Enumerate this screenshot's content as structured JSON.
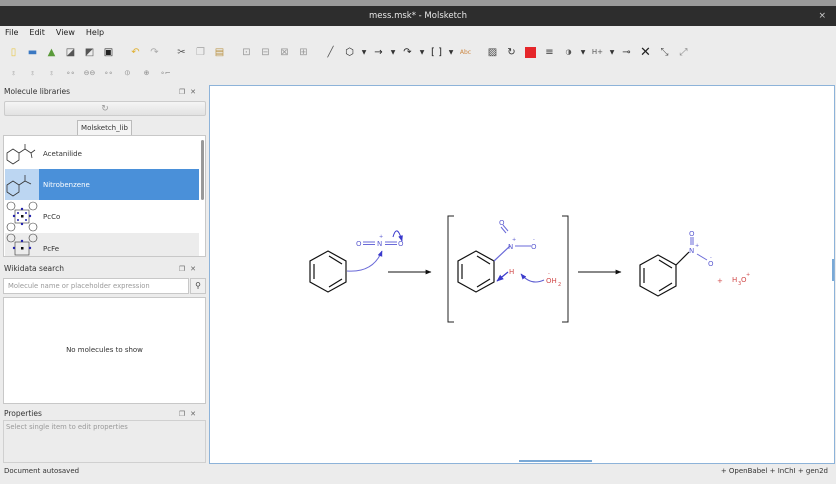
{
  "window": {
    "title": "mess.msk* - Molsketch",
    "close": "×"
  },
  "menu": [
    "File",
    "Edit",
    "View",
    "Help"
  ],
  "toolbar": {
    "charge_label": "H+",
    "text_tool_label": "Abc",
    "accent_color": "#e5262a"
  },
  "molecule_libraries": {
    "title": "Molecule libraries",
    "tab": "Molsketch_lib",
    "items": [
      {
        "name": "Acetanilide"
      },
      {
        "name": "Nitrobenzene",
        "selected": true
      },
      {
        "name": "PcCo"
      },
      {
        "name": "PcFe"
      }
    ]
  },
  "wikidata_search": {
    "title": "Wikidata search",
    "placeholder": "Molecule name or placeholder expression",
    "empty_message": "No molecules to show"
  },
  "properties": {
    "title": "Properties",
    "hint": "Select single item to edit properties"
  },
  "canvas": {
    "labels": {
      "o": "O",
      "n": "N",
      "plus": "+",
      "minus": "-",
      "h": "H",
      "oh2": "OH",
      "sub2": "2",
      "h3o": "H",
      "sub3": "3",
      "o_plus": "O",
      "plus_sign": "+"
    }
  },
  "status": {
    "left": "Document autosaved",
    "right": "+ OpenBabel + InChI + gen2d"
  }
}
